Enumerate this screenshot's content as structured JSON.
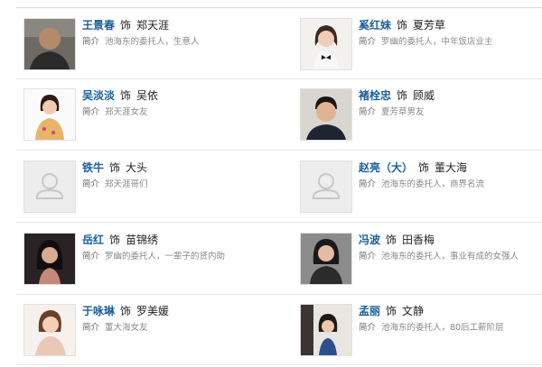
{
  "cast": [
    {
      "name": "王景春",
      "as": "饰",
      "role": "郑天涯",
      "bio_label": "简介",
      "bio": "池海东的委托人，生意人",
      "photo": "actor-photo"
    },
    {
      "name": "奚红妹",
      "as": "饰",
      "role": "夏芳草",
      "bio_label": "简介",
      "bio": "罗幽的委托人，中年饭店业主",
      "photo": "actress-photo"
    },
    {
      "name": "吴淡淡",
      "as": "饰",
      "role": "吴依",
      "bio_label": "简介",
      "bio": "郑天涯女友",
      "photo": "actress-photo"
    },
    {
      "name": "褚栓忠",
      "as": "饰",
      "role": "顾威",
      "bio_label": "简介",
      "bio": "夏芳草男友",
      "photo": "actor-photo"
    },
    {
      "name": "铁牛",
      "as": "饰",
      "role": "大头",
      "bio_label": "简介",
      "bio": "郑天涯哥们",
      "photo": "placeholder-avatar"
    },
    {
      "name": "赵亮（大）",
      "as": "饰",
      "role": "董大海",
      "bio_label": "简介",
      "bio": "池海东的委托人，商界名流",
      "photo": "placeholder-avatar"
    },
    {
      "name": "岳红",
      "as": "饰",
      "role": "苗锦绣",
      "bio_label": "简介",
      "bio": "罗幽的委托人，一辈子的贤内助",
      "photo": "actress-photo"
    },
    {
      "name": "冯波",
      "as": "饰",
      "role": "田香梅",
      "bio_label": "简介",
      "bio": "池海东的委托人，事业有成的女强人",
      "photo": "actress-photo"
    },
    {
      "name": "于咏琳",
      "as": "饰",
      "role": "罗美媛",
      "bio_label": "简介",
      "bio": "董大海女友",
      "photo": "actress-photo"
    },
    {
      "name": "孟丽",
      "as": "饰",
      "role": "文静",
      "bio_label": "简介",
      "bio": "池海东的委托人，80后工薪阶层",
      "photo": "actress-photo"
    }
  ],
  "colors": {
    "name_link": "#1b5f99",
    "divider": "#e8e8e8",
    "placeholder_bg": "#ededed"
  }
}
